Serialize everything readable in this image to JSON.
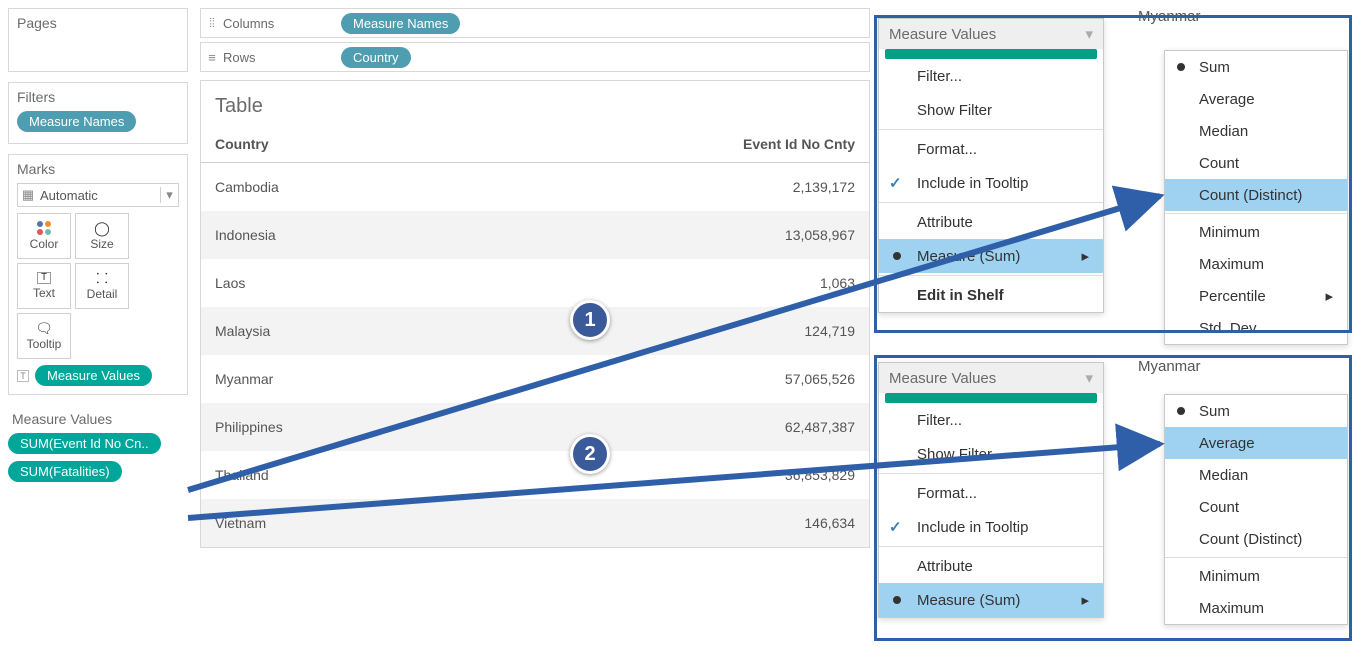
{
  "shelves": {
    "pages_title": "Pages",
    "filters_title": "Filters",
    "filters_pill": "Measure Names",
    "marks_title": "Marks",
    "marks_type": "Automatic",
    "marks_cells": {
      "color": "Color",
      "size": "Size",
      "text": "Text",
      "detail": "Detail",
      "tooltip": "Tooltip"
    },
    "marks_pill": "Measure Values",
    "mv_title": "Measure Values",
    "mv_pills": [
      "SUM(Event Id No Cn..",
      "SUM(Fatalities)"
    ]
  },
  "cr": {
    "columns_label": "Columns",
    "columns_pill": "Measure Names",
    "rows_label": "Rows",
    "rows_pill": "Country"
  },
  "view": {
    "title": "Table",
    "col_country": "Country",
    "col_value": "Event Id No Cnty",
    "rows": [
      {
        "country": "Cambodia",
        "value": "2,139,172"
      },
      {
        "country": "Indonesia",
        "value": "13,058,967"
      },
      {
        "country": "Laos",
        "value": "1,063"
      },
      {
        "country": "Malaysia",
        "value": "124,719"
      },
      {
        "country": "Myanmar",
        "value": "57,065,526"
      },
      {
        "country": "Philippines",
        "value": "62,487,387"
      },
      {
        "country": "Thailand",
        "value": "36,853,829"
      },
      {
        "country": "Vietnam",
        "value": "146,634"
      }
    ]
  },
  "menu": {
    "header": "Measure Values",
    "items": {
      "filter": "Filter...",
      "show_filter": "Show Filter",
      "format": "Format...",
      "tooltip": "Include in Tooltip",
      "attribute": "Attribute",
      "measure": "Measure (Sum)",
      "edit": "Edit in Shelf"
    }
  },
  "submenu": {
    "title_country": "Myanmar",
    "items": {
      "sum": "Sum",
      "average": "Average",
      "median": "Median",
      "count": "Count",
      "count_distinct": "Count (Distinct)",
      "minimum": "Minimum",
      "maximum": "Maximum",
      "percentile": "Percentile",
      "std_dev": "Std. Dev"
    }
  },
  "annot": {
    "one": "1",
    "two": "2"
  }
}
